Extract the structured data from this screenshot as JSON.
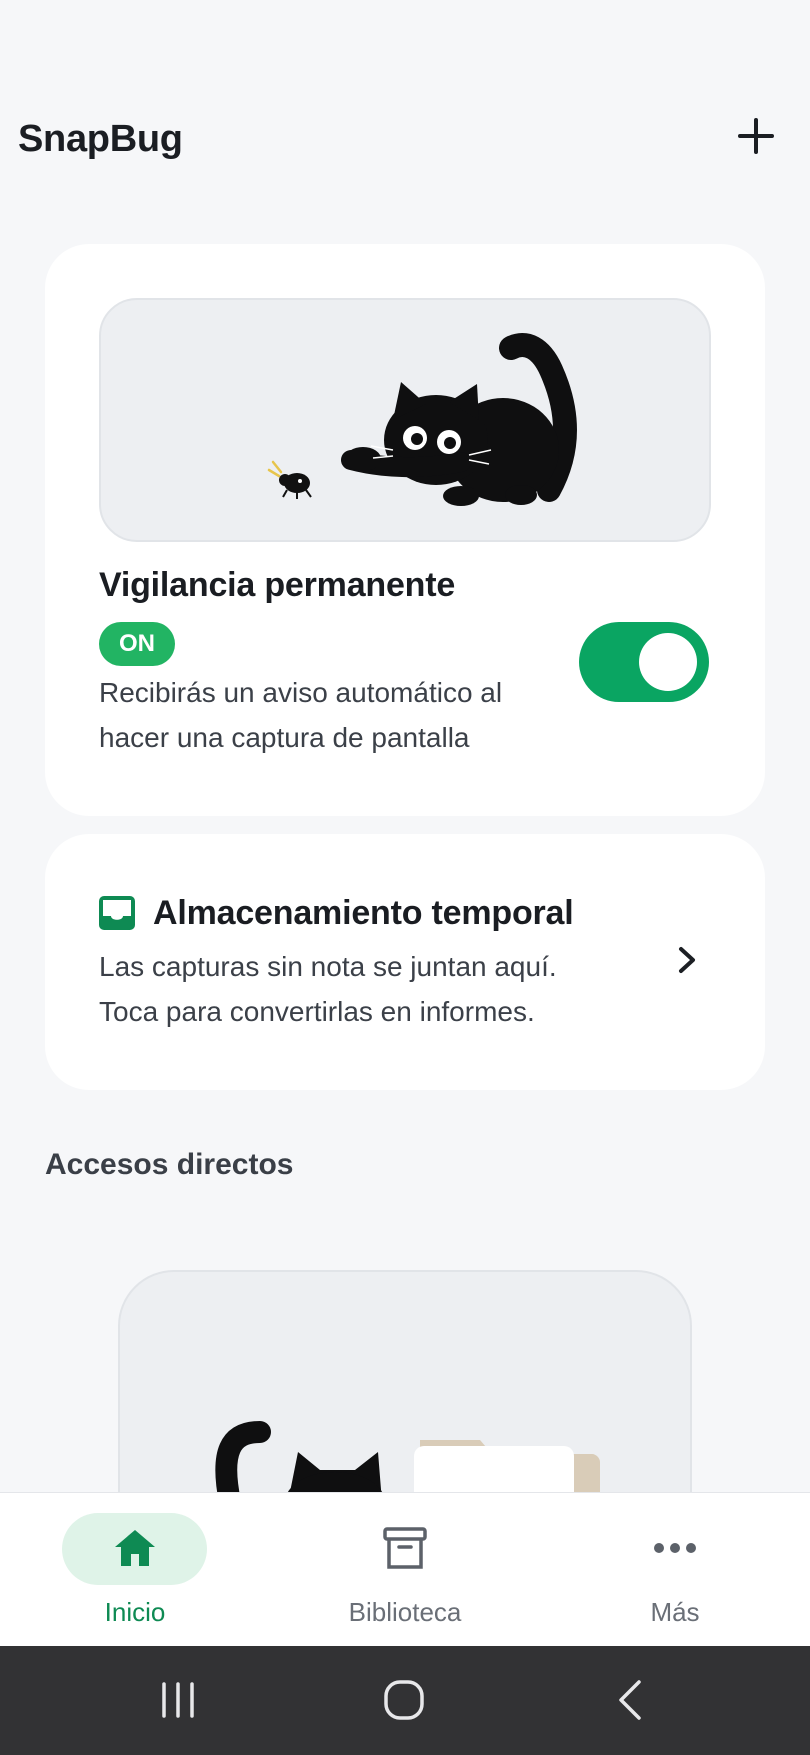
{
  "app": {
    "title": "SnapBug",
    "add_icon": "plus-icon"
  },
  "watch_card": {
    "title": "Vigilancia permanente",
    "status_badge": "ON",
    "description": "Recibirás un aviso automático al hacer una captura de pantalla",
    "toggle_on": true,
    "illustration": "black-cat-chasing-bug"
  },
  "storage_card": {
    "icon": "inbox-icon",
    "title": "Almacenamiento temporal",
    "description": "Las capturas sin nota se juntan aquí. Toca para convertirlas en informes."
  },
  "shortcuts": {
    "section_title": "Accesos directos"
  },
  "bottom_nav": {
    "items": [
      {
        "label": "Inicio",
        "icon": "home-icon",
        "active": true
      },
      {
        "label": "Biblioteca",
        "icon": "archive-icon",
        "active": false
      },
      {
        "label": "Más",
        "icon": "more-dots-icon",
        "active": false
      }
    ]
  },
  "colors": {
    "accent": "#0aa562",
    "badge": "#22b463",
    "active_nav": "#0e8a53",
    "background": "#f6f7f9"
  }
}
